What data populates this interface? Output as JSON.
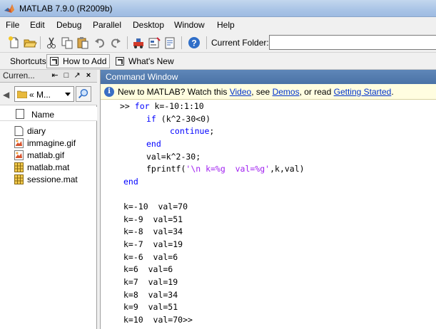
{
  "window": {
    "title": "MATLAB  7.9.0 (R2009b)"
  },
  "menu": [
    "File",
    "Edit",
    "Debug",
    "Parallel",
    "Desktop",
    "Window",
    "Help"
  ],
  "toolbar": {
    "current_folder_label": "Current Folder:",
    "current_folder_value": "",
    "icons": [
      "new-file-icon",
      "open-folder-icon",
      "cut-icon",
      "copy-icon",
      "paste-icon",
      "undo-icon",
      "redo-icon",
      "simulink-icon",
      "guide-icon",
      "profiler-icon",
      "help-icon"
    ]
  },
  "shortcuts": {
    "label": "Shortcuts",
    "items": [
      "How to Add",
      "What's New"
    ]
  },
  "left_panel": {
    "title": "Curren...",
    "path": "« M...",
    "column_header": "Name",
    "files": [
      {
        "name": "diary",
        "icon": "text-file-icon"
      },
      {
        "name": "immagine.gif",
        "icon": "image-file-icon"
      },
      {
        "name": "matlab.gif",
        "icon": "image-file-icon"
      },
      {
        "name": "matlab.mat",
        "icon": "mat-file-icon"
      },
      {
        "name": "sessione.mat",
        "icon": "mat-file-icon"
      }
    ]
  },
  "command_window": {
    "title": "Command Window",
    "info": {
      "prefix": "New to MATLAB? Watch this ",
      "link_video": "Video",
      "sep1": ", see ",
      "link_demos": "Demos",
      "sep2": ", or read ",
      "link_getting_started": "Getting Started",
      "suffix": "."
    },
    "code": {
      "prompt": ">> ",
      "l1_kw": "for",
      "l1_rest": " k=-10:1:10",
      "l2_kw": "if",
      "l2_rest": " (k^2-30<0)",
      "l3_kw": "continue",
      "l3_rest": ";",
      "l4_kw": "end",
      "l5": "val=k^2-30;",
      "l6_a": "fprintf(",
      "l6_str": "'\\n k=%g  val=%g'",
      "l6_b": ",k,val)",
      "l7_kw": "end"
    },
    "output": [
      "k=-10  val=70",
      "k=-9  val=51",
      "k=-8  val=34",
      "k=-7  val=19",
      "k=-6  val=6",
      "k=6  val=6",
      "k=7  val=19",
      "k=8  val=34",
      "k=9  val=51",
      "k=10  val=70>>"
    ]
  },
  "colors": {
    "keyword": "#0000ff",
    "string": "#a020f0",
    "link": "#0033cc",
    "title_bar": "#4a72a6"
  }
}
